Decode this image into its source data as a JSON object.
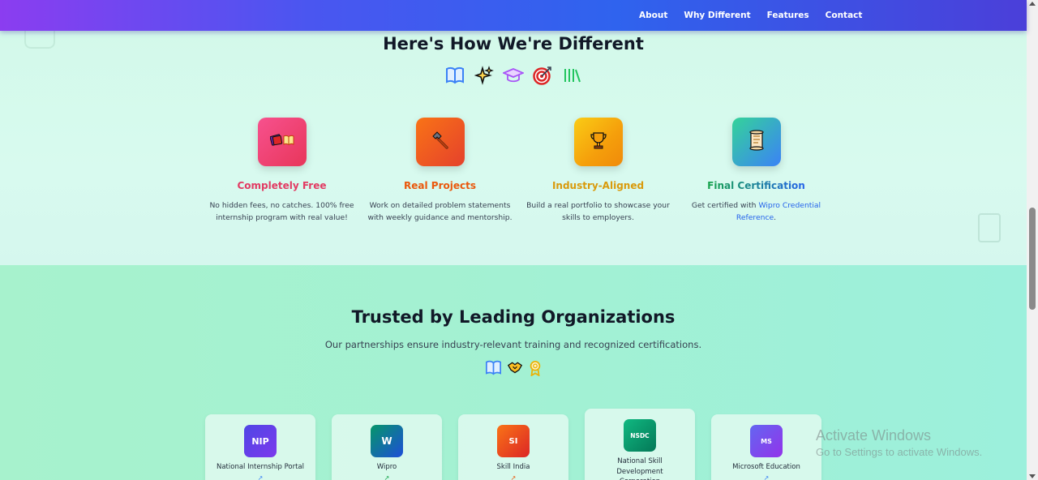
{
  "nav": {
    "links": [
      "About",
      "Why Different",
      "Features",
      "Contact"
    ]
  },
  "different": {
    "title": "Here's How We're Different",
    "icons": [
      "open-book-icon",
      "sparkles-icon",
      "graduation-cap-icon",
      "target-icon",
      "books-icon"
    ],
    "features": [
      {
        "icon": "books-icon",
        "title": "Completely Free",
        "desc": "No hidden fees, no catches. 100% free internship program with real value!",
        "color": "#e23b63",
        "tile": [
          "#f7518e",
          "#e8365a"
        ]
      },
      {
        "icon": "hammer-icon",
        "title": "Real Projects",
        "desc": "Work on detailed problem statements with weekly guidance and mentorship.",
        "color": "#ea580c",
        "tile": [
          "#f97316",
          "#e5412c"
        ]
      },
      {
        "icon": "trophy-icon",
        "title": "Industry-Aligned",
        "desc": "Build a real portfolio to showcase your skills to employers.",
        "color": "#d99a0b",
        "tile": [
          "#facc15",
          "#f59e0b"
        ]
      },
      {
        "icon": "scroll-icon",
        "title": "Final Certification",
        "desc_prefix": "Get certified with ",
        "desc_link": "Wipro Credential Reference",
        "desc_suffix": ".",
        "color": "#16a34a",
        "tile": [
          "#34d399",
          "#3b82f6"
        ]
      }
    ]
  },
  "trusted": {
    "title": "Trusted by Leading Organizations",
    "subtitle": "Our partnerships ensure industry-relevant training and recognized certifications.",
    "icons": [
      "open-book-icon",
      "handshake-icon",
      "medal-icon"
    ],
    "orgs": [
      {
        "abbr": "NIP",
        "name": "National Internship Portal",
        "color": "#4f46e5"
      },
      {
        "abbr": "W",
        "name": "Wipro",
        "color": "#0e7490"
      },
      {
        "abbr": "SI",
        "name": "Skill India",
        "color": "#ea4b1d"
      },
      {
        "abbr": "NSDC",
        "name": "National Skill Development Corporation",
        "color": "#0f9d6b"
      },
      {
        "abbr": "MS",
        "name": "Microsoft Education",
        "color": "#7c3aed"
      }
    ],
    "link_icon": "external-link-icon"
  },
  "watermark": {
    "title": "Activate Windows",
    "subtitle": "Go to Settings to activate Windows."
  }
}
